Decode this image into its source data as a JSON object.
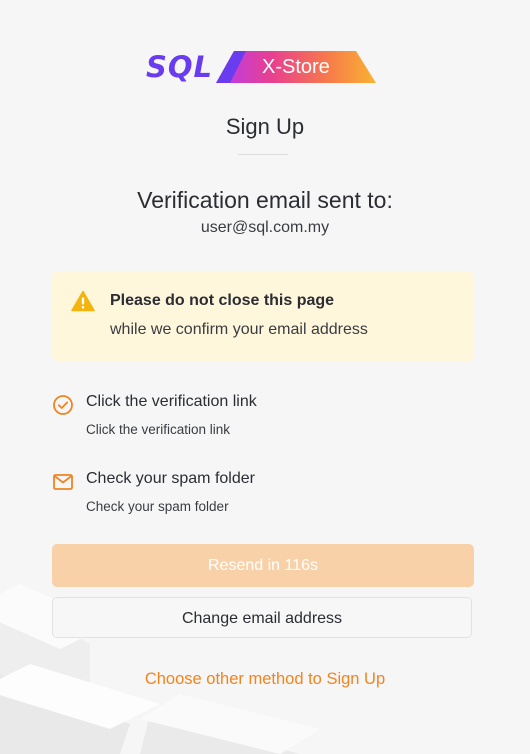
{
  "brand": {
    "logo_text": "SQL",
    "product_label": "X-Store",
    "colors": {
      "primary": "#6a3cf0",
      "gradient_start": "#c93bd6",
      "gradient_mid": "#f25a6e",
      "gradient_end": "#f9b333"
    }
  },
  "page": {
    "title": "Sign Up",
    "heading": "Verification email sent to:",
    "email": "user@sql.com.my"
  },
  "warning": {
    "icon": "warning-triangle-icon",
    "title": "Please do not close this page",
    "text": "while we confirm your email address",
    "background": "#fef7dc",
    "icon_color": "#f5b30d"
  },
  "steps": [
    {
      "icon": "check-circle-icon",
      "title": "Click the verification link",
      "subtitle": "Click the verification link"
    },
    {
      "icon": "mail-icon",
      "title": "Check your spam folder",
      "subtitle": "Check your spam folder"
    }
  ],
  "actions": {
    "resend_label": "Resend in 116s",
    "change_email_label": "Change email address",
    "other_method_label": "Choose other method to Sign Up"
  },
  "colors": {
    "accent": "#f0841f",
    "resend_disabled_bg": "#f9d1a9",
    "text": "#2b2d33"
  }
}
